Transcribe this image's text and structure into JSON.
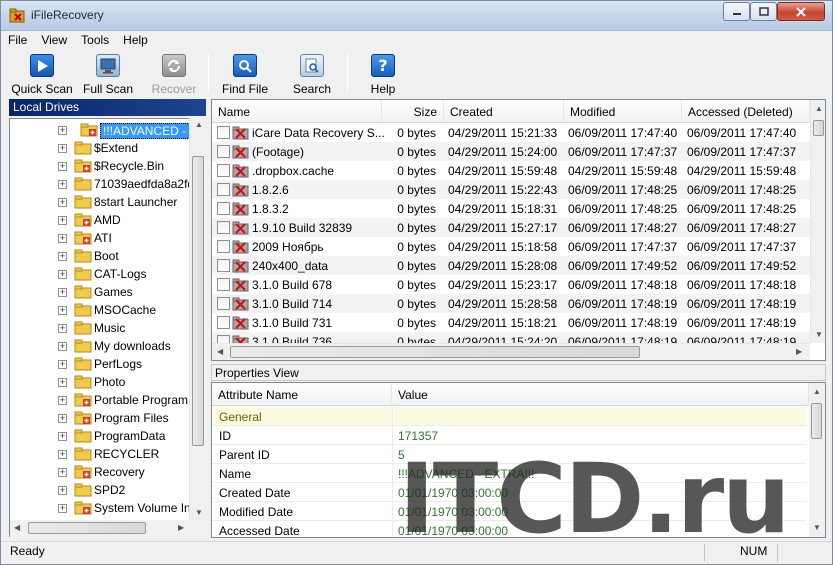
{
  "window": {
    "title": "iFileRecovery"
  },
  "menu": [
    "File",
    "View",
    "Tools",
    "Help"
  ],
  "toolbar": [
    {
      "label": "Quick Scan",
      "icon": "play-icon",
      "enabled": true
    },
    {
      "label": "Full Scan",
      "icon": "computer-icon",
      "enabled": true
    },
    {
      "label": "Recover",
      "icon": "recover-icon",
      "enabled": false
    },
    {
      "label": "Find File",
      "icon": "find-icon",
      "enabled": true
    },
    {
      "label": "Search",
      "icon": "search-icon",
      "enabled": true
    },
    {
      "label": "Help",
      "icon": "help-icon",
      "enabled": true
    }
  ],
  "left_panel": {
    "title": "Local Drives"
  },
  "tree": [
    {
      "label": "!!!ADVANCED - EXTRA",
      "selected": true,
      "deleted": true
    },
    {
      "label": "$Extend"
    },
    {
      "label": "$Recycle.Bin",
      "deleted": true
    },
    {
      "label": "71039aedfda8a2fd"
    },
    {
      "label": "8start Launcher"
    },
    {
      "label": "AMD",
      "deleted": true
    },
    {
      "label": "ATI",
      "deleted": true
    },
    {
      "label": "Boot"
    },
    {
      "label": "CAT-Logs"
    },
    {
      "label": "Games"
    },
    {
      "label": "MSOCache"
    },
    {
      "label": "Music"
    },
    {
      "label": "My downloads"
    },
    {
      "label": "PerfLogs"
    },
    {
      "label": "Photo"
    },
    {
      "label": "Portable Program",
      "deleted": true
    },
    {
      "label": "Program Files",
      "deleted": true
    },
    {
      "label": "ProgramData"
    },
    {
      "label": "RECYCLER"
    },
    {
      "label": "Recovery",
      "deleted": true
    },
    {
      "label": "SPD2"
    },
    {
      "label": "System Volume In",
      "deleted": true
    }
  ],
  "files": {
    "columns": [
      "Name",
      "Size",
      "Created",
      "Modified",
      "Accessed (Deleted)"
    ],
    "rows": [
      {
        "name": "iCare Data Recovery S...",
        "size": "0 bytes",
        "created": "04/29/2011 15:21:33",
        "modified": "06/09/2011 17:47:40",
        "accessed": "06/09/2011 17:47:40"
      },
      {
        "name": "(Footage)",
        "size": "0 bytes",
        "created": "04/29/2011 15:24:00",
        "modified": "06/09/2011 17:47:37",
        "accessed": "06/09/2011 17:47:37"
      },
      {
        "name": ".dropbox.cache",
        "size": "0 bytes",
        "created": "04/29/2011 15:59:48",
        "modified": "04/29/2011 15:59:48",
        "accessed": "04/29/2011 15:59:48"
      },
      {
        "name": "1.8.2.6",
        "size": "0 bytes",
        "created": "04/29/2011 15:22:43",
        "modified": "06/09/2011 17:48:25",
        "accessed": "06/09/2011 17:48:25"
      },
      {
        "name": "1.8.3.2",
        "size": "0 bytes",
        "created": "04/29/2011 15:18:31",
        "modified": "06/09/2011 17:48:25",
        "accessed": "06/09/2011 17:48:25"
      },
      {
        "name": "1.9.10 Build 32839",
        "size": "0 bytes",
        "created": "04/29/2011 15:27:17",
        "modified": "06/09/2011 17:48:27",
        "accessed": "06/09/2011 17:48:27"
      },
      {
        "name": "2009 Ноябрь",
        "size": "0 bytes",
        "created": "04/29/2011 15:18:58",
        "modified": "06/09/2011 17:47:37",
        "accessed": "06/09/2011 17:47:37"
      },
      {
        "name": "240x400_data",
        "size": "0 bytes",
        "created": "04/29/2011 15:28:08",
        "modified": "06/09/2011 17:49:52",
        "accessed": "06/09/2011 17:49:52"
      },
      {
        "name": "3.1.0 Build 678",
        "size": "0 bytes",
        "created": "04/29/2011 15:23:17",
        "modified": "06/09/2011 17:48:18",
        "accessed": "06/09/2011 17:48:18"
      },
      {
        "name": "3.1.0 Build 714",
        "size": "0 bytes",
        "created": "04/29/2011 15:28:58",
        "modified": "06/09/2011 17:48:19",
        "accessed": "06/09/2011 17:48:19"
      },
      {
        "name": "3.1.0 Build 731",
        "size": "0 bytes",
        "created": "04/29/2011 15:18:21",
        "modified": "06/09/2011 17:48:19",
        "accessed": "06/09/2011 17:48:19"
      },
      {
        "name": "3.1.0 Build 736",
        "size": "0 bytes",
        "created": "04/29/2011 15:24:20",
        "modified": "06/09/2011 17:48:19",
        "accessed": "06/09/2011 17:48:19"
      }
    ]
  },
  "properties": {
    "title": "Properties View",
    "columns": [
      "Attribute Name",
      "Value"
    ],
    "rows": [
      {
        "name": "General",
        "value": "",
        "group": true
      },
      {
        "name": "ID",
        "value": "171357"
      },
      {
        "name": "Parent ID",
        "value": "5"
      },
      {
        "name": "Name",
        "value": "!!!ADVANCED - EXTRA!!!"
      },
      {
        "name": "Created Date",
        "value": "01/01/1970 03:00:00"
      },
      {
        "name": "Modified Date",
        "value": "01/01/1970 03:00:00"
      },
      {
        "name": "Accessed Date",
        "value": "01/01/1970 03:00:00"
      }
    ]
  },
  "status": {
    "text": "Ready",
    "num": "NUM"
  },
  "watermark": "ITCD.ru",
  "colors": {
    "selection": "#3399ff",
    "value_green": "#2b7a2b",
    "header_blue": "#0a246a"
  }
}
